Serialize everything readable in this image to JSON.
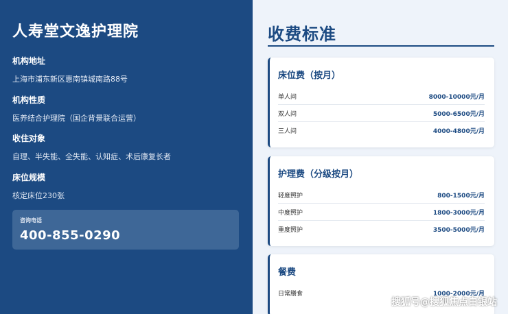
{
  "left_panel": {
    "org_name": "人寿堂文逸护理院",
    "fields": [
      {
        "label": "机构地址",
        "value": "上海市浦东新区惠南镇城南路88号"
      },
      {
        "label": "机构性质",
        "value": "医养结合护理院（国企背景联合运营）"
      },
      {
        "label": "收住对象",
        "value": "自理、半失能、全失能、认知症、术后康复长者"
      },
      {
        "label": "床位规模",
        "value": "核定床位230张"
      }
    ],
    "phone": {
      "label": "咨询电话",
      "number": "400-855-0290"
    }
  },
  "right_panel": {
    "title": "收费标准",
    "cards": [
      {
        "title": "床位费（按月）",
        "rows": [
          {
            "label": "单人间",
            "price": "8000-10000元/月"
          },
          {
            "label": "双人间",
            "price": "5000-6500元/月"
          },
          {
            "label": "三人间",
            "price": "4000-4800元/月"
          }
        ]
      },
      {
        "title": "护理费（分级按月）",
        "rows": [
          {
            "label": "轻度照护",
            "price": "800-1500元/月"
          },
          {
            "label": "中度照护",
            "price": "1800-3000元/月"
          },
          {
            "label": "重度照护",
            "price": "3500-5000元/月"
          }
        ]
      },
      {
        "title": "餐费",
        "rows": [
          {
            "label": "日常膳食",
            "price": "1000-2000元/月"
          }
        ]
      }
    ]
  },
  "watermark": "搜狐号@搜狐焦点白银站",
  "colors": {
    "primary": "#1c4a82",
    "background": "#eef3fa",
    "phone_box": "#3e6797"
  }
}
